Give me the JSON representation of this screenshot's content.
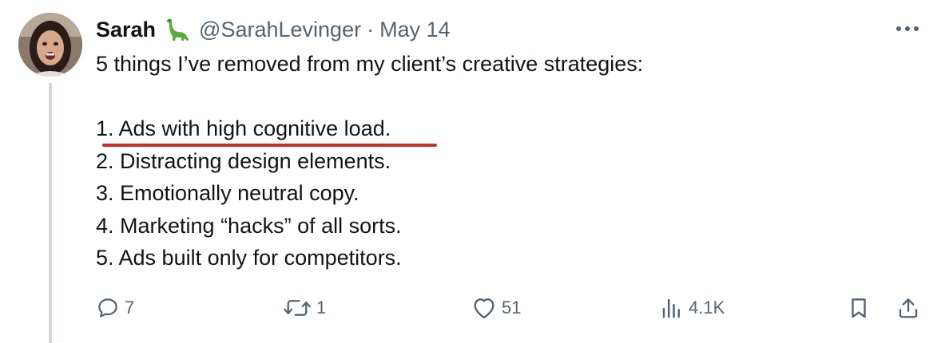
{
  "tweet": {
    "author": {
      "display_name": "Sarah",
      "name_emoji": "sauropod",
      "handle": "@SarahLevinger",
      "separator": "·",
      "date": "May 14"
    },
    "lines": [
      "5 things I’ve removed from my client’s creative strategies:",
      "",
      "1. Ads with high cognitive load.",
      "2. Distracting design elements.",
      "3. Emotionally neutral copy.",
      "4. Marketing “hacks” of all sorts.",
      "5. Ads built only for competitors."
    ],
    "highlighted_line_index": 2,
    "metrics": {
      "replies": "7",
      "retweets": "1",
      "likes": "51",
      "views": "4.1K"
    },
    "icons": {
      "reply": "reply-icon",
      "retweet": "retweet-icon",
      "like": "like-icon",
      "views": "views-icon",
      "bookmark": "bookmark-icon",
      "share": "share-icon",
      "more": "more-icon"
    }
  },
  "colors": {
    "text": "#0f1419",
    "secondary": "#536471",
    "thread_line": "#cfd9de",
    "underline": "#c62f2a"
  }
}
